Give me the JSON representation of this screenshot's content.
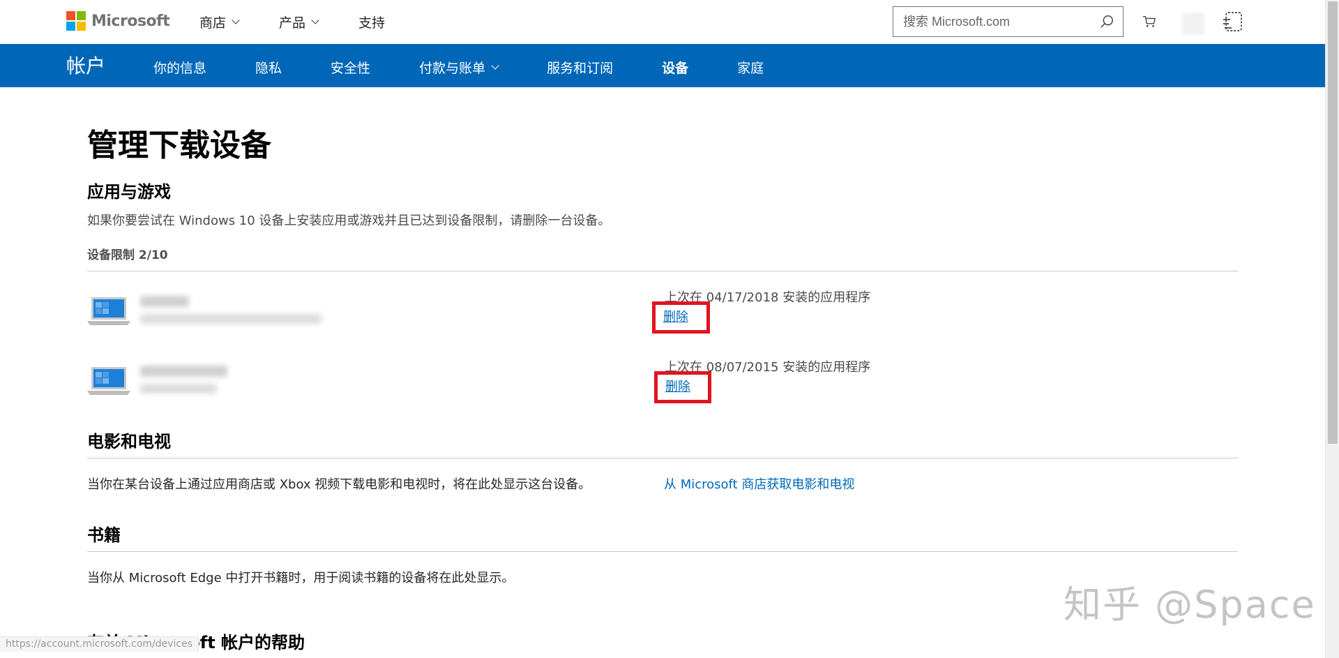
{
  "header": {
    "brand": "Microsoft",
    "nav": [
      {
        "label": "商店",
        "has_dropdown": true
      },
      {
        "label": "产品",
        "has_dropdown": true
      },
      {
        "label": "支持",
        "has_dropdown": false
      }
    ],
    "search_placeholder": "搜索 Microsoft.com",
    "icons": [
      "search-icon",
      "cart-icon",
      "profile-icon"
    ],
    "logo_colors": [
      "#f25022",
      "#7fba00",
      "#00a4ef",
      "#ffb900"
    ]
  },
  "account_nav": {
    "title": "帐户",
    "tabs": [
      {
        "label": "你的信息",
        "active": false
      },
      {
        "label": "隐私",
        "active": false
      },
      {
        "label": "安全性",
        "active": false
      },
      {
        "label": "付款与账单",
        "active": false,
        "has_dropdown": true
      },
      {
        "label": "服务和订阅",
        "active": false
      },
      {
        "label": "设备",
        "active": true
      },
      {
        "label": "家庭",
        "active": false
      }
    ],
    "bg_color": "#0067b8"
  },
  "main": {
    "page_title": "管理下载设备",
    "apps": {
      "heading": "应用与游戏",
      "description": "如果你要尝试在 Windows 10 设备上安装应用或游戏并且已达到设备限制，请删除一台设备。",
      "limit": "设备限制 2/10",
      "devices": [
        {
          "install_info": "上次在 04/17/2018 安装的应用程序",
          "delete_label": "删除"
        },
        {
          "install_info": "上次在 08/07/2015 安装的应用程序",
          "delete_label": "删除"
        }
      ]
    },
    "movies": {
      "heading": "电影和电视",
      "description": "当你在某台设备上通过应用商店或 Xbox 视频下载电影和电视时，将在此处显示这台设备。",
      "link": "从 Microsoft 商店获取电影和电视"
    },
    "books": {
      "heading": "书籍",
      "description": "当你从 Microsoft Edge 中打开书籍时，用于阅读书籍的设备将在此处显示。"
    },
    "help": {
      "heading": "有关 Microsoft 帐户的帮助"
    }
  },
  "overlay": {
    "watermark": "知乎 @Space",
    "status_url": "https://account.microsoft.com/devices",
    "highlight_color": "#e0141f"
  }
}
